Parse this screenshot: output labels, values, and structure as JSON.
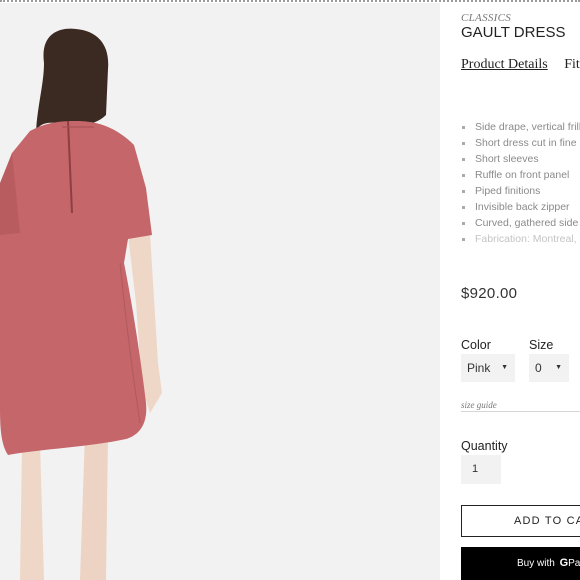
{
  "product": {
    "collection": "CLASSICS",
    "title": "GAULT DRESS",
    "price": "$920.00"
  },
  "tabs": [
    {
      "label": "Product Details",
      "active": true
    },
    {
      "label": "Fit",
      "active": false
    }
  ],
  "details": [
    "Side drape, vertical frill",
    "Short dress cut in fine s",
    "Short sleeves",
    "Ruffle on front panel",
    "Piped finitions",
    "Invisible back zipper",
    "Curved, gathered side",
    "Fabrication: Montreal, C"
  ],
  "options": {
    "color_label": "Color",
    "color_value": "Pink",
    "size_label": "Size",
    "size_value": "0",
    "size_guide": "size guide"
  },
  "quantity": {
    "label": "Quantity",
    "value": "1"
  },
  "buttons": {
    "add_to_cart": "ADD TO CAR",
    "buy_with_prefix": "Buy with",
    "gpay_g": "G",
    "gpay_text": "Pay"
  },
  "colors": {
    "dress": "#c4666a",
    "accent": "#222222"
  },
  "icons": {
    "select_caret": "caret-down-icon"
  }
}
